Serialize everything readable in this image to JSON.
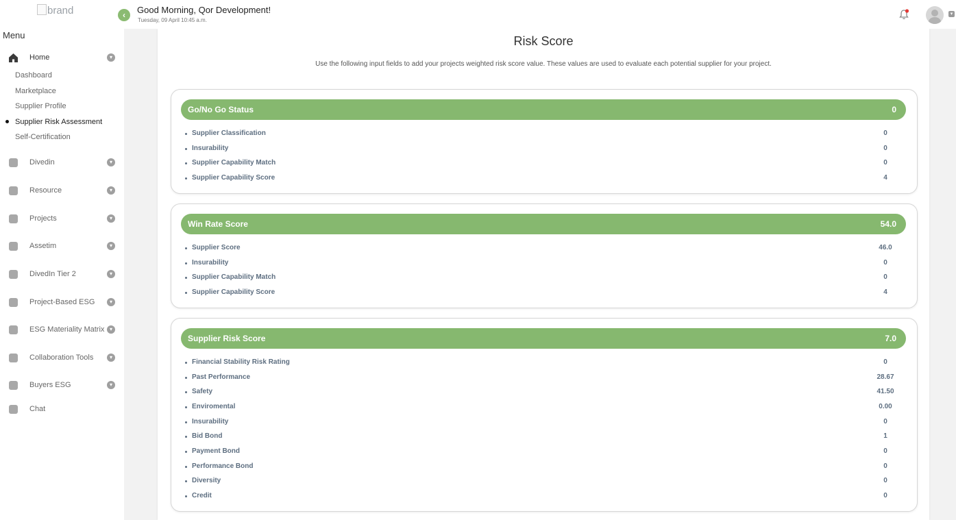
{
  "header": {
    "brand_alt": "brand",
    "greeting": "Good Morning, Qor Development!",
    "date": "Tuesday, 09 April 10:45 a.m.",
    "colors": {
      "accent": "#86b86f",
      "notification_dot": "#e53935"
    },
    "icons": {
      "collapse": "chevron-left-icon",
      "notifications": "bell-icon",
      "user": "avatar-icon"
    }
  },
  "sidebar": {
    "title": "Menu",
    "groups": [
      {
        "label": "Home",
        "icon": "home-icon",
        "expanded": true
      },
      {
        "label": "Divedin",
        "icon": "camera-icon"
      },
      {
        "label": "Resource",
        "icon": "folder-icon"
      },
      {
        "label": "Projects",
        "icon": "briefcase-icon"
      },
      {
        "label": "Assetim",
        "icon": "chart-icon"
      },
      {
        "label": "DivedIn Tier 2",
        "icon": "clipboard-icon"
      },
      {
        "label": "Project-Based ESG",
        "icon": "briefcase-icon"
      },
      {
        "label": "ESG Materiality Matrix",
        "icon": "briefcase-icon"
      },
      {
        "label": "Collaboration Tools",
        "icon": "briefcase-icon"
      },
      {
        "label": "Buyers ESG",
        "icon": "chart-icon"
      },
      {
        "label": "Chat",
        "icon": "briefcase-icon"
      }
    ],
    "home_subitems": [
      {
        "label": "Dashboard"
      },
      {
        "label": "Marketplace"
      },
      {
        "label": "Supplier Profile"
      },
      {
        "label": "Supplier Risk Assessment",
        "active": true
      },
      {
        "label": "Self-Certification"
      }
    ]
  },
  "main": {
    "title": "Risk Score",
    "description": "Use the following input fields to add your projects weighted risk score value. These values are used to evaluate each potential supplier for your project.",
    "cards": [
      {
        "title": "Go/No Go Status",
        "total": "0",
        "rows": [
          {
            "label": "Supplier Classification",
            "value": "0"
          },
          {
            "label": "Insurability",
            "value": "0"
          },
          {
            "label": "Supplier Capability Match",
            "value": "0"
          },
          {
            "label": "Supplier Capability Score",
            "value": "4"
          }
        ]
      },
      {
        "title": "Win Rate Score",
        "total": "54.0",
        "rows": [
          {
            "label": "Supplier Score",
            "value": "46.0"
          },
          {
            "label": "Insurability",
            "value": "0"
          },
          {
            "label": "Supplier Capability Match",
            "value": "0"
          },
          {
            "label": "Supplier Capability Score",
            "value": "4"
          }
        ]
      },
      {
        "title": "Supplier Risk Score",
        "total": "7.0",
        "rows": [
          {
            "label": "Financial Stability Risk Rating",
            "value": "0"
          },
          {
            "label": "Past Performance",
            "value": "28.67"
          },
          {
            "label": "Safety",
            "value": "41.50"
          },
          {
            "label": "Enviromental",
            "value": "0.00"
          },
          {
            "label": "Insurability",
            "value": "0"
          },
          {
            "label": "Bid Bond",
            "value": "1"
          },
          {
            "label": "Payment Bond",
            "value": "0"
          },
          {
            "label": "Performance Bond",
            "value": "0"
          },
          {
            "label": "Diversity",
            "value": "0"
          },
          {
            "label": "Credit",
            "value": "0"
          }
        ]
      }
    ]
  }
}
